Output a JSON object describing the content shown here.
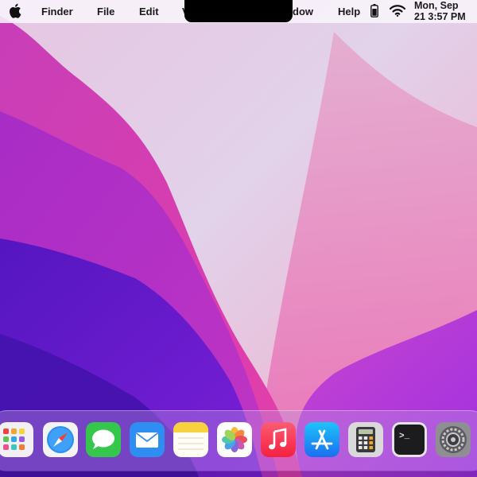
{
  "menubar": {
    "app_name": "Finder",
    "menus": [
      "File",
      "Edit",
      "V",
      "dow",
      "Help"
    ],
    "clock_line1": "Mon, Sep",
    "clock_line2": "21 3:57 PM"
  },
  "dock": {
    "apps": [
      "launchpad-icon",
      "safari-icon",
      "messages-icon",
      "mail-icon",
      "notes-icon",
      "photos-icon",
      "music-icon",
      "app-store-icon",
      "calculator-icon",
      "terminal-icon",
      "system-preferences-icon"
    ],
    "terminal_prompt": ">_"
  },
  "colors": {
    "menubar_bg": "#f8f4fa",
    "wallpaper_pink": "#e03aa8",
    "wallpaper_purple": "#7a1fd6",
    "wallpaper_deep": "#4a13b8"
  }
}
